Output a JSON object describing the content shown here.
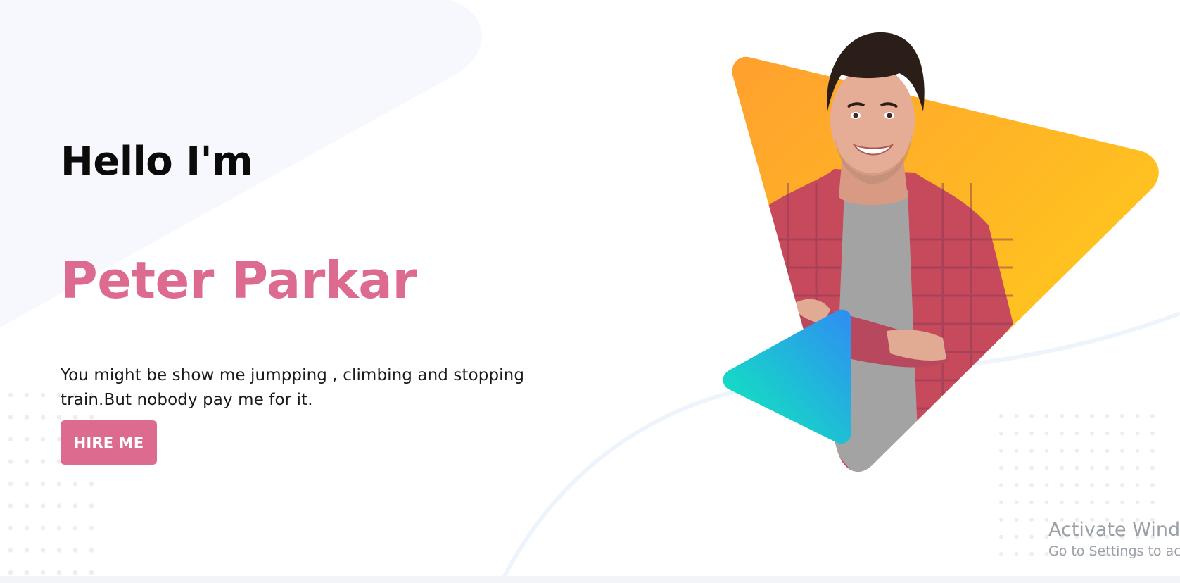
{
  "hero": {
    "greeting": "Hello I'm",
    "name": "Peter Parkar",
    "bio": "You might be show me jumpping , climbing and stopping train.But nobody pay me for it.",
    "cta_label": "HIRE ME"
  },
  "watermark": {
    "title": "Activate Windo",
    "subtitle": "Go to Settings to ac"
  },
  "colors": {
    "accent": "#dc6b8f",
    "heading": "#0b0b0b",
    "triangle_orange": "#ffa02e",
    "triangle_yellow": "#ffd319",
    "triangle_teal": "#0ef0b8",
    "triangle_blue": "#2f8cf4"
  },
  "icons": {
    "portrait": "person-portrait-image"
  }
}
